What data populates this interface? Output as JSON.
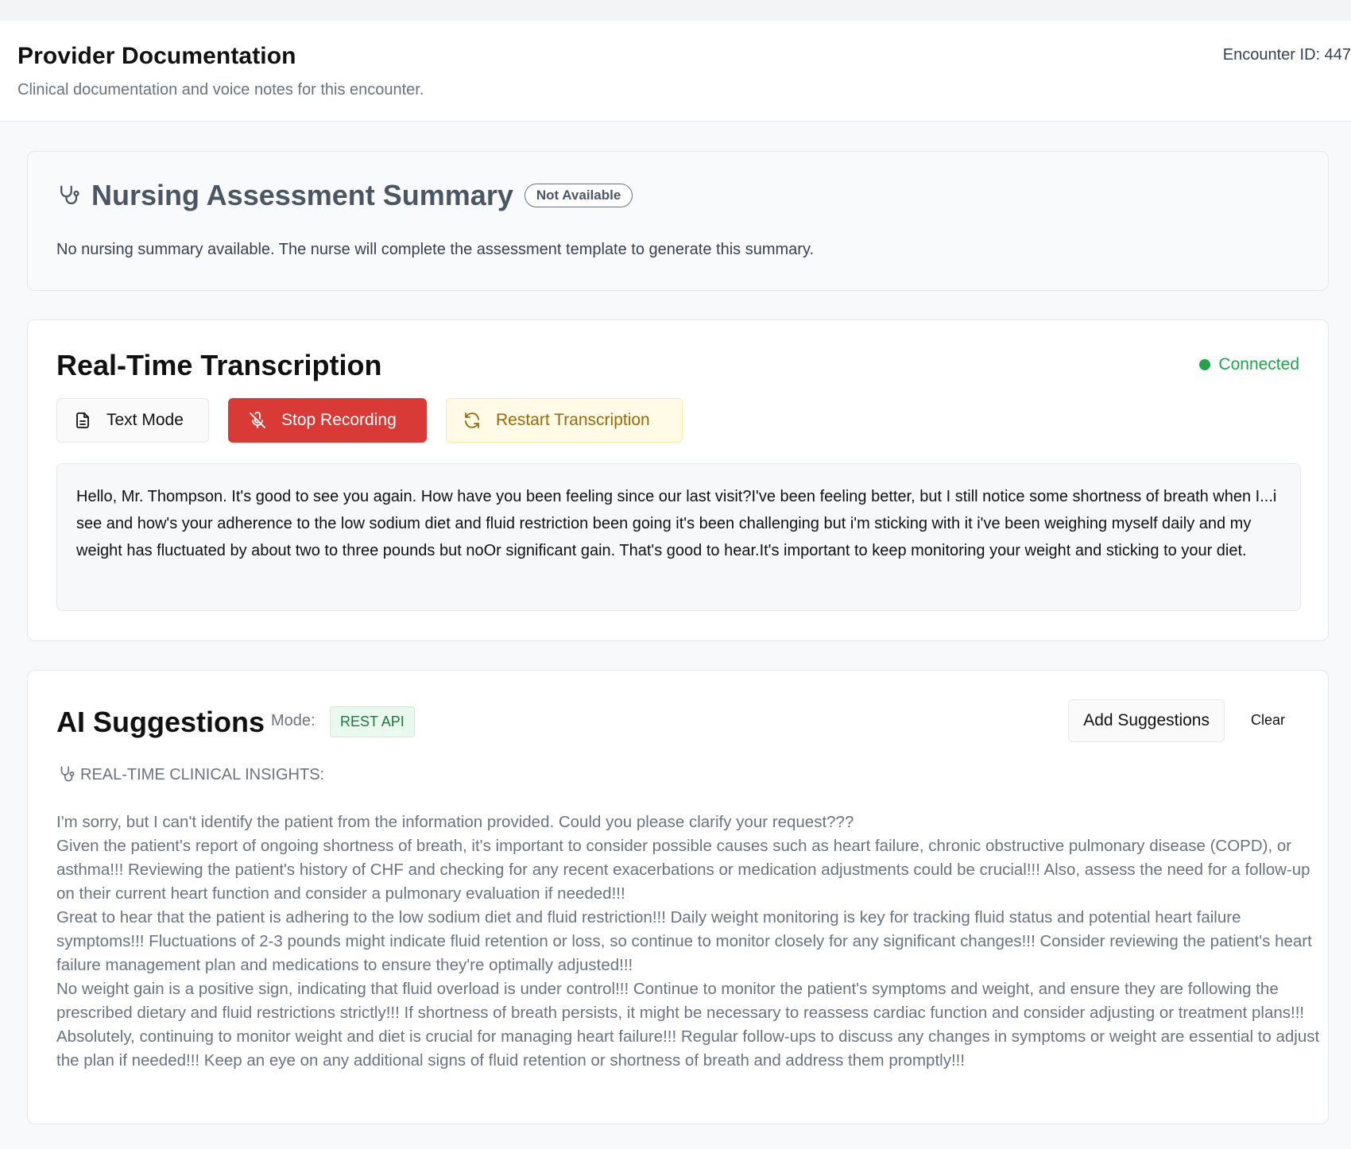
{
  "header": {
    "title": "Provider Documentation",
    "subtitle": "Clinical documentation and voice notes for this encounter.",
    "encounter": "Encounter ID: 447"
  },
  "nursing": {
    "title": "Nursing Assessment Summary",
    "badge": "Not Available",
    "message": "No nursing summary available. The nurse will complete the assessment template to generate this summary.",
    "icon": "stethoscope-icon"
  },
  "transcription": {
    "title": "Real-Time Transcription",
    "status": "Connected",
    "status_color": "#22a24a",
    "buttons": {
      "text_mode": "Text Mode",
      "stop": "Stop Recording",
      "restart": "Restart Transcription"
    },
    "text": "Hello, Mr. Thompson. It's good to see you again. How have you been feeling since our last visit?I've been feeling better, but I still notice some shortness of breath when I...i see and how's your adherence to the low sodium diet and fluid restriction been going it's been challenging but i'm sticking with it i've been weighing myself daily and my weight has fluctuated by about two to three pounds but noOr significant gain. That's good to hear.It's important to keep monitoring your weight and sticking to your diet."
  },
  "ai": {
    "title": "AI Suggestions",
    "mode_label": "Mode:",
    "mode_value": "REST API",
    "add_button": "Add Suggestions",
    "clear_button": "Clear",
    "insights_heading": "REAL-TIME CLINICAL INSIGHTS:",
    "paragraphs": [
      "I'm sorry, but I can't identify the patient from the information provided. Could you please clarify your request???",
      "Given the patient's report of ongoing shortness of breath, it's important to consider possible causes such as heart failure, chronic obstructive pulmonary disease (COPD), or asthma!!! Reviewing the patient's history of CHF and checking for any recent exacerbations or medication adjustments could be crucial!!! Also, assess the need for a follow-up on their current heart function and consider a pulmonary evaluation if needed!!!",
      "Great to hear that the patient is adhering to the low sodium diet and fluid restriction!!! Daily weight monitoring is key for tracking fluid status and potential heart failure symptoms!!! Fluctuations of 2-3 pounds might indicate fluid retention or loss, so continue to monitor closely for any significant changes!!! Consider reviewing the patient's heart failure management plan and medications to ensure they're optimally adjusted!!!",
      "No weight gain is a positive sign, indicating that fluid overload is under control!!! Continue to monitor the patient's symptoms and weight, and ensure they are following the prescribed dietary and fluid restrictions strictly!!! If shortness of breath persists, it might be necessary to reassess cardiac function and consider adjusting or treatment plans!!!",
      "Absolutely, continuing to monitor weight and diet is crucial for managing heart failure!!! Regular follow-ups to discuss any changes in symptoms or weight are essential to adjust the plan if needed!!! Keep an eye on any additional signs of fluid retention or shortness of breath and address them promptly!!!"
    ]
  }
}
